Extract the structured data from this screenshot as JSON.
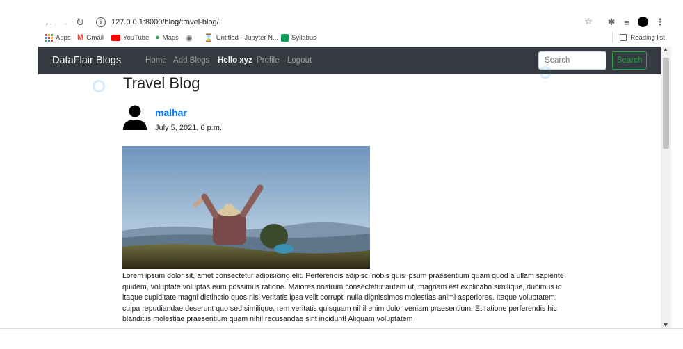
{
  "browser": {
    "url": "127.0.0.1:8000/blog/travel-blog/",
    "bookmarks": [
      {
        "label": "Apps",
        "color": "#e8453c"
      },
      {
        "label": "Gmail",
        "color": "#ea4335"
      },
      {
        "label": "YouTube",
        "color": "#ff0000"
      },
      {
        "label": "Maps",
        "color": "#34a853"
      },
      {
        "label": "",
        "color": "#5f6368"
      },
      {
        "label": "Untitled - Jupyter N...",
        "color": "#f37726"
      },
      {
        "label": "Syllabus",
        "color": "#0f9d58"
      }
    ],
    "reading_list": "Reading list"
  },
  "navbar": {
    "brand": "DataFlair Blogs",
    "links": [
      "Home",
      "Add Blogs",
      "Hello xyz",
      "Profile",
      "Logout"
    ],
    "search_placeholder": "Search",
    "search_button": "Search",
    "bg_color": "#343a40",
    "accent_color": "#28a745"
  },
  "post": {
    "title": "Travel Blog",
    "author": "malhar",
    "date": "July 5, 2021, 6 p.m.",
    "body": "Lorem ipsum dolor sit, amet consectetur adipisicing elit. Perferendis adipisci nobis quis ipsum praesentium quam quod a ullam sapiente quidem, voluptate voluptas eum possimus ratione. Maiores nostrum consectetur autem ut, magnam est explicabo similique, ducimus id itaque cupiditate magni distinctio quos nisi veritatis ipsa velit corrupti nulla dignissimos molestias animi asperiores. Itaque voluptatem, culpa repudiandae deserunt quo sed similique, rem veritatis quisquam nihil enim dolor veniam praesentium. Et ratione perferendis hic blanditiis molestiae praesentium quam nihil recusandae sint incidunt! Aliquam voluptatem"
  }
}
